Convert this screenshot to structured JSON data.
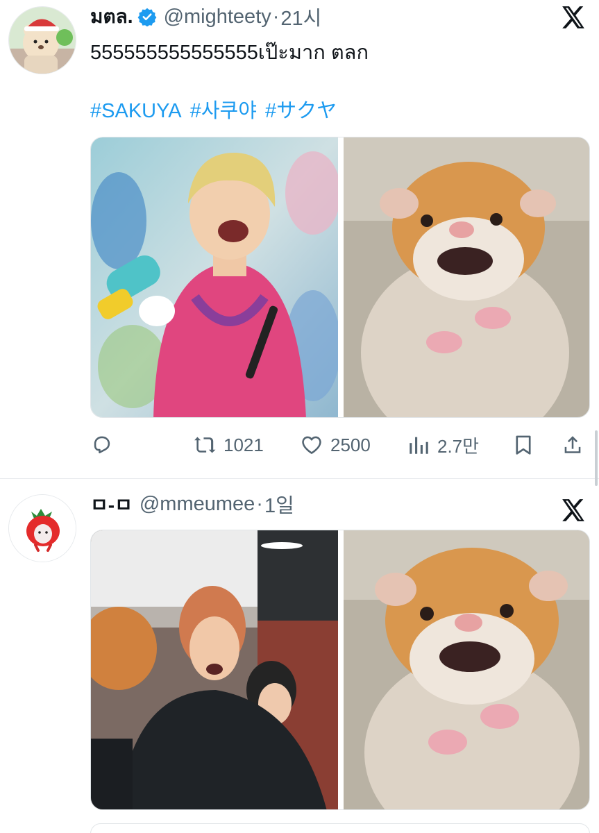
{
  "tweets": [
    {
      "display_name": "มตล.",
      "verified": true,
      "handle": "@mighteety",
      "separator": "·",
      "time": "21시",
      "text": "555555555555555เป๊ะมาก ตลก",
      "hashtags": [
        "#SAKUYA",
        "#사쿠야",
        "#サクヤ"
      ],
      "media": [
        "performer-photo",
        "hamster-photo"
      ],
      "actions": {
        "reply_icon": "reply-icon",
        "retweet_icon": "retweet-icon",
        "retweet_count": "1021",
        "like_icon": "heart-icon",
        "like_count": "2500",
        "views_icon": "views-icon",
        "views_count": "2.7만",
        "bookmark_icon": "bookmark-icon",
        "share_icon": "share-icon"
      }
    },
    {
      "display_name": "ㅁ-ㅁ",
      "verified": false,
      "handle": "@mmeumee",
      "separator": "·",
      "time": "1일",
      "media": [
        "crowd-photo",
        "hamster-photo"
      ]
    }
  ],
  "colors": {
    "text": "#0f1419",
    "secondary": "#536471",
    "link": "#1d9bf0",
    "verified": "#1d9bf0"
  }
}
